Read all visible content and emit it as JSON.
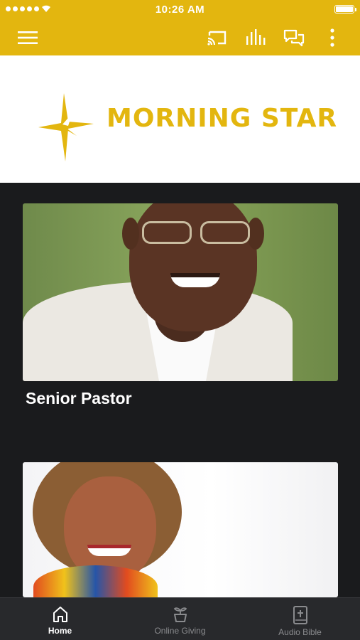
{
  "status_bar": {
    "time": "10:26 AM",
    "signal_dots": 5
  },
  "app_bar": {
    "icons": [
      "menu-icon",
      "cast-icon",
      "audio-bars-icon",
      "chat-icon",
      "more-vert-icon"
    ]
  },
  "brand": {
    "name": "MORNING STAR",
    "accent_color": "#e3b60f"
  },
  "cards": [
    {
      "title": "Senior Pastor"
    },
    {
      "title": ""
    }
  ],
  "bottom_nav": {
    "items": [
      {
        "label": "Home",
        "icon": "home-icon",
        "active": true
      },
      {
        "label": "Online Giving",
        "icon": "giving-plant-icon",
        "active": false
      },
      {
        "label": "Audio Bible",
        "icon": "bible-icon",
        "active": false
      }
    ]
  }
}
